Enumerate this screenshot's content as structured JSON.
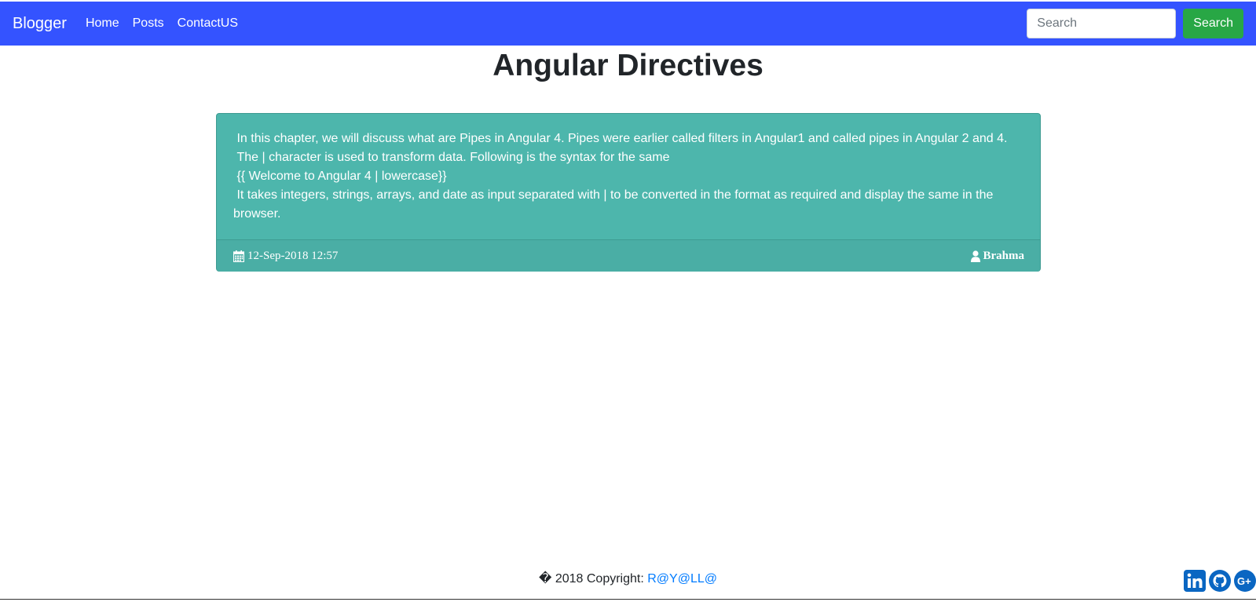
{
  "navbar": {
    "brand": "Blogger",
    "links": [
      "Home",
      "Posts",
      "ContactUS"
    ],
    "search_placeholder": "Search",
    "search_button": "Search",
    "background_color": "#3453ff"
  },
  "main": {
    "title": "Angular Directives",
    "post": {
      "lines": [
        " In this chapter, we will discuss what are Pipes in Angular 4. Pipes were earlier called filters in Angular1 and called pipes in Angular 2 and 4.",
        " The | character is used to transform data. Following is the syntax for the same",
        " {{ Welcome to Angular 4 | lowercase}}",
        " It takes integers, strings, arrays, and date as input separated with | to be converted in the format as required and display the same in the browser."
      ],
      "date": "12-Sep-2018 12:57",
      "author": "Brahma",
      "date_icon": "calendar-icon",
      "author_icon": "user-icon",
      "card_color": "#4db6ac"
    }
  },
  "footer": {
    "copyright_prefix": "� 2018 Copyright: ",
    "copyright_link": "R@Y@LL@",
    "social_icons": [
      "linkedin-icon",
      "github-icon",
      "google-plus-icon"
    ]
  }
}
